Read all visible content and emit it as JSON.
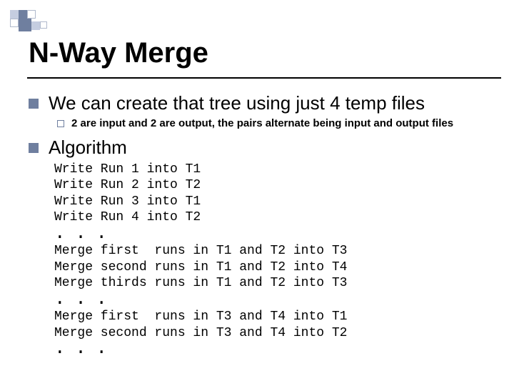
{
  "title": "N-Way Merge",
  "bullets": {
    "b1": "We can create that tree using just 4 temp files",
    "b1sub": "2 are input and 2 are output, the pairs alternate being input and output files",
    "b2": "Algorithm"
  },
  "code": {
    "l1": "Write Run 1 into T1",
    "l2": "Write Run 2 into T2",
    "l3": "Write Run 3 into T1",
    "l4": "Write Run 4 into T2",
    "l5": "Merge first  runs in T1 and T2 into T3",
    "l6": "Merge second runs in T1 and T2 into T4",
    "l7": "Merge thirds runs in T1 and T2 into T3",
    "l8": "Merge first  runs in T3 and T4 into T1",
    "l9": "Merge second runs in T3 and T4 into T2",
    "ell": ". . ."
  }
}
